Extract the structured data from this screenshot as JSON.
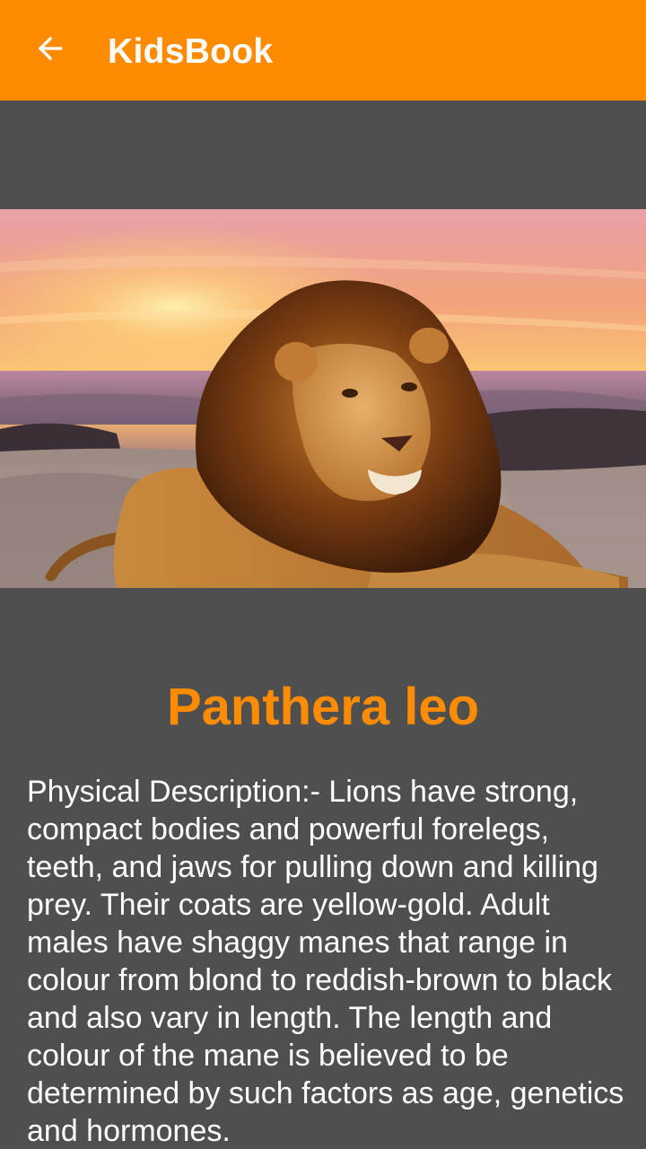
{
  "toolbar": {
    "back_icon": "arrow-left-icon",
    "title": "KidsBook",
    "color": "#ff8c00"
  },
  "hero": {
    "subject": "lion-photo"
  },
  "animal": {
    "name": "Panthera leo",
    "name_color": "#ff8c00",
    "description": "Physical Description:- Lions have strong, compact bodies and powerful forelegs, teeth, and jaws for pulling down and killing prey. Their coats are yellow-gold. Adult males have shaggy manes that range in colour from blond to reddish-brown to black and also vary in length. The length and colour of the mane is believed to be determined by such factors as age, genetics and hormones."
  },
  "background_color": "#4f4f4f"
}
